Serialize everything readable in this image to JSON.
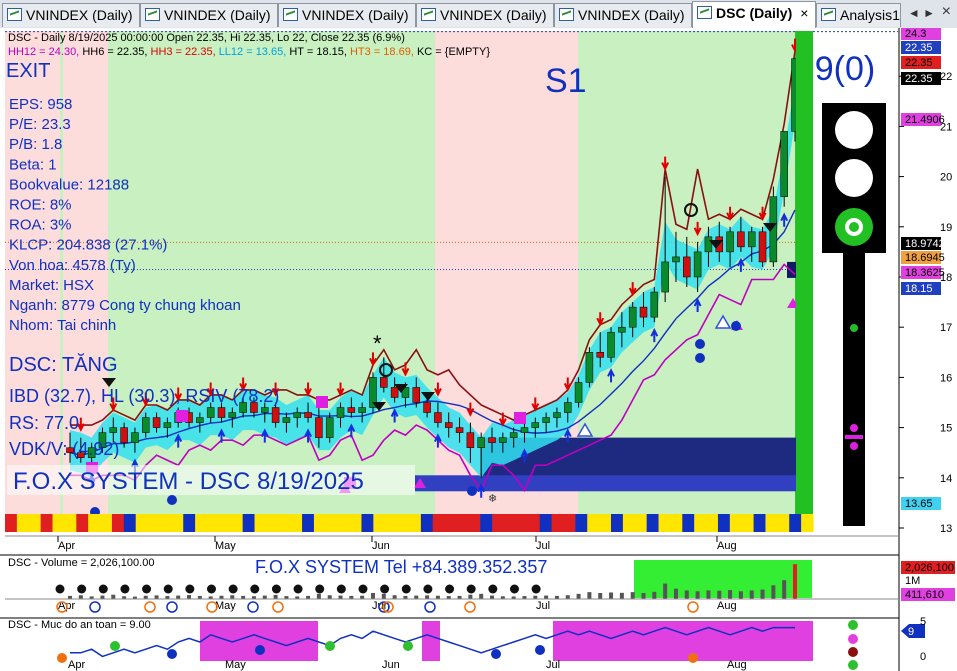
{
  "tabs": [
    {
      "label": "VNINDEX (Daily)",
      "active": false
    },
    {
      "label": "VNINDEX (Daily)",
      "active": false
    },
    {
      "label": "VNINDEX (Daily)",
      "active": false
    },
    {
      "label": "VNINDEX (Daily)",
      "active": false
    },
    {
      "label": "VNINDEX (Daily)",
      "active": false
    },
    {
      "label": "DSC (Daily)",
      "active": true
    },
    {
      "label": "Analysis1",
      "active": false
    }
  ],
  "tab_close": "×",
  "tab_nav": "◄ ►",
  "tab_close_all": "×",
  "header": {
    "line1": "DSC - Daily 8/19/2025 00:00:00 Open 22.35, Hi 22.35, Lo 22, Close 22.35 (6.9%)",
    "line2": [
      {
        "text": "HH12 = 24.30, ",
        "color": "#c000c0"
      },
      {
        "text": "HH6 = 22.35, ",
        "color": "#000000"
      },
      {
        "text": "HH3 = 22.35, ",
        "color": "#e00000"
      },
      {
        "text": "LL12 = 13.65, ",
        "color": "#00a0e0"
      },
      {
        "text": "HT = 18.15, ",
        "color": "#000000"
      },
      {
        "text": "HT3 = 18.69, ",
        "color": "#e06000"
      },
      {
        "text": "KC = {EMPTY}",
        "color": "#000000"
      }
    ]
  },
  "overlay": {
    "exit": "EXIT",
    "signal": "S1",
    "count": "9(0)",
    "fundamentals": [
      "EPS: 958",
      "P/E: 23.3",
      "P/B: 1.8",
      "Beta: 1",
      "Bookvalue: 12188",
      "ROE: 8%",
      "ROA: 3%",
      "KLCP: 204.838 (27.1%)",
      "Von hoa: 4578 (Ty)",
      "Market: HSX",
      "Nganh: 8779 Cong ty chung khoan",
      "Nhom: Tai chinh"
    ],
    "trend": "DSC: TĂNG",
    "ibd": "IBD (32.7), HL (30.3), RSIV (78.2)",
    "rs": "RS: 77.0",
    "vdk": "VDK/V:  (4.92)",
    "system": "F.O.X SYSTEM - DSC 8/19/2025",
    "phone": "F.O.X SYSTEM Tel +84.389.352.357"
  },
  "price_axis": {
    "ticks": [
      "22",
      "21",
      "20",
      "19",
      "18",
      "17",
      "16",
      "15",
      "14",
      "13"
    ],
    "labels": [
      {
        "text": "24.3",
        "bg": "#e040e0",
        "fg": "#000"
      },
      {
        "text": "22.35",
        "bg": "#2040c0",
        "fg": "#fff"
      },
      {
        "text": "22.35",
        "bg": "#e02020",
        "fg": "#000"
      },
      {
        "text": "22.35",
        "bg": "#000",
        "fg": "#fff"
      },
      {
        "text": "21.4906",
        "bg": "#e040e0",
        "fg": "#000"
      },
      {
        "text": "18.9742",
        "bg": "#000",
        "fg": "#fff"
      },
      {
        "text": "18.6945",
        "bg": "#f0a040",
        "fg": "#000"
      },
      {
        "text": "18.3625",
        "bg": "#e040e0",
        "fg": "#000"
      },
      {
        "text": "18.15",
        "bg": "#2040c0",
        "fg": "#fff"
      },
      {
        "text": "13.65",
        "bg": "#40d0f0",
        "fg": "#000"
      }
    ]
  },
  "x_axis": {
    "months": [
      "Apr",
      "May",
      "Jun",
      "Jul",
      "Aug"
    ]
  },
  "volume_panel": {
    "title": "DSC - Volume = 2,026,100.00",
    "labels": [
      {
        "text": "2,026,100",
        "bg": "#e02020",
        "fg": "#000"
      },
      {
        "text": "1M",
        "bg": "#fff",
        "fg": "#000"
      },
      {
        "text": "411,610",
        "bg": "#e040e0",
        "fg": "#000"
      }
    ]
  },
  "safety_panel": {
    "title": "DSC - Muc do an toan = 9.00",
    "value": "9",
    "ticks": [
      "5",
      "0"
    ]
  },
  "chart_data": {
    "type": "candlestick",
    "ylim": [
      13,
      22.9
    ],
    "title": "DSC - Daily 8/19/2025",
    "last": {
      "open": 22.35,
      "high": 22.35,
      "low": 22,
      "close": 22.35,
      "change_pct": 6.9
    },
    "ohlc": [
      [
        14.6,
        14.9,
        14.3,
        14.5
      ],
      [
        14.5,
        14.8,
        14.3,
        14.4
      ],
      [
        14.4,
        14.7,
        14.2,
        14.6
      ],
      [
        14.6,
        15.0,
        14.5,
        14.9
      ],
      [
        14.9,
        15.2,
        14.7,
        15.0
      ],
      [
        15.0,
        15.1,
        14.6,
        14.7
      ],
      [
        14.7,
        15.0,
        14.5,
        14.9
      ],
      [
        14.9,
        15.3,
        14.8,
        15.2
      ],
      [
        15.2,
        15.3,
        14.9,
        15.0
      ],
      [
        15.0,
        15.2,
        14.8,
        15.1
      ],
      [
        15.1,
        15.4,
        15.0,
        15.3
      ],
      [
        15.3,
        15.4,
        15.0,
        15.1
      ],
      [
        15.1,
        15.3,
        14.9,
        15.2
      ],
      [
        15.2,
        15.5,
        15.1,
        15.4
      ],
      [
        15.4,
        15.5,
        15.1,
        15.2
      ],
      [
        15.2,
        15.4,
        15.0,
        15.3
      ],
      [
        15.3,
        15.6,
        15.2,
        15.5
      ],
      [
        15.5,
        15.6,
        15.2,
        15.3
      ],
      [
        15.3,
        15.5,
        15.1,
        15.4
      ],
      [
        15.4,
        15.5,
        15.0,
        15.1
      ],
      [
        15.1,
        15.3,
        14.9,
        15.2
      ],
      [
        15.2,
        15.4,
        15.0,
        15.3
      ],
      [
        15.3,
        15.5,
        15.1,
        15.2
      ],
      [
        15.2,
        15.4,
        14.6,
        14.8
      ],
      [
        14.8,
        15.3,
        14.7,
        15.2
      ],
      [
        15.2,
        15.5,
        15.0,
        15.4
      ],
      [
        15.4,
        15.6,
        15.2,
        15.3
      ],
      [
        15.3,
        15.5,
        15.1,
        15.4
      ],
      [
        15.4,
        16.1,
        15.3,
        16.0
      ],
      [
        16.0,
        16.4,
        15.7,
        15.8
      ],
      [
        15.8,
        16.0,
        15.5,
        15.6
      ],
      [
        15.6,
        15.9,
        15.4,
        15.8
      ],
      [
        15.8,
        16.0,
        15.4,
        15.5
      ],
      [
        15.5,
        15.7,
        15.2,
        15.3
      ],
      [
        15.3,
        15.5,
        15.0,
        15.1
      ],
      [
        15.1,
        15.3,
        14.8,
        15.0
      ],
      [
        15.0,
        15.2,
        14.7,
        14.9
      ],
      [
        14.9,
        15.1,
        14.3,
        14.6
      ],
      [
        14.6,
        14.9,
        14.0,
        14.8
      ],
      [
        14.8,
        15.0,
        14.5,
        14.7
      ],
      [
        14.7,
        14.9,
        14.5,
        14.8
      ],
      [
        14.8,
        15.0,
        14.6,
        14.9
      ],
      [
        14.9,
        15.1,
        14.7,
        15.0
      ],
      [
        15.0,
        15.2,
        14.8,
        15.1
      ],
      [
        15.1,
        15.3,
        14.9,
        15.2
      ],
      [
        15.2,
        15.4,
        15.0,
        15.3
      ],
      [
        15.3,
        15.6,
        15.1,
        15.5
      ],
      [
        15.5,
        16.0,
        15.4,
        15.9
      ],
      [
        15.9,
        16.6,
        15.8,
        16.5
      ],
      [
        16.5,
        16.9,
        16.2,
        16.4
      ],
      [
        16.4,
        17.0,
        16.3,
        16.9
      ],
      [
        16.9,
        17.3,
        16.6,
        17.0
      ],
      [
        17.0,
        17.5,
        16.8,
        17.4
      ],
      [
        17.4,
        17.7,
        17.0,
        17.2
      ],
      [
        17.2,
        17.8,
        17.1,
        17.7
      ],
      [
        17.7,
        20.0,
        17.5,
        18.3
      ],
      [
        18.3,
        18.9,
        17.9,
        18.4
      ],
      [
        18.4,
        18.8,
        17.8,
        18.0
      ],
      [
        18.0,
        18.7,
        17.7,
        18.5
      ],
      [
        18.5,
        19.0,
        18.2,
        18.8
      ],
      [
        18.8,
        19.1,
        18.3,
        18.5
      ],
      [
        18.5,
        19.0,
        18.2,
        18.9
      ],
      [
        18.9,
        19.2,
        18.5,
        18.6
      ],
      [
        18.6,
        19.0,
        18.3,
        18.9
      ],
      [
        18.9,
        19.0,
        18.2,
        18.3
      ],
      [
        18.3,
        19.8,
        18.2,
        19.6
      ],
      [
        19.6,
        20.9,
        19.4,
        20.9
      ],
      [
        20.9,
        22.35,
        20.7,
        22.35
      ]
    ],
    "volume": [
      0.18,
      0.22,
      0.15,
      0.2,
      0.25,
      0.16,
      0.14,
      0.19,
      0.21,
      0.17,
      0.2,
      0.23,
      0.18,
      0.15,
      0.19,
      0.22,
      0.18,
      0.16,
      0.2,
      0.24,
      0.17,
      0.15,
      0.18,
      0.3,
      0.22,
      0.2,
      0.18,
      0.19,
      0.35,
      0.3,
      0.22,
      0.18,
      0.2,
      0.21,
      0.19,
      0.17,
      0.18,
      0.25,
      0.3,
      0.2,
      0.16,
      0.15,
      0.17,
      0.19,
      0.2,
      0.18,
      0.22,
      0.3,
      0.4,
      0.35,
      0.38,
      0.36,
      0.4,
      0.35,
      0.42,
      0.9,
      0.6,
      0.5,
      0.45,
      0.5,
      0.48,
      0.52,
      0.45,
      0.5,
      0.55,
      0.8,
      1.1,
      2.03
    ],
    "safety": [
      2,
      2,
      3,
      1,
      2,
      3,
      2,
      3,
      4,
      3,
      5,
      6,
      5,
      7,
      6,
      5,
      6,
      7,
      6,
      5,
      4,
      5,
      6,
      5,
      4,
      6,
      7,
      6,
      8,
      7,
      6,
      5,
      6,
      7,
      6,
      5,
      4,
      3,
      2,
      3,
      4,
      5,
      6,
      7,
      6,
      7,
      8,
      7,
      8,
      7,
      6,
      7,
      8,
      7,
      8,
      9,
      8,
      7,
      8,
      9,
      8,
      7,
      8,
      9,
      8,
      9,
      9,
      9
    ]
  }
}
